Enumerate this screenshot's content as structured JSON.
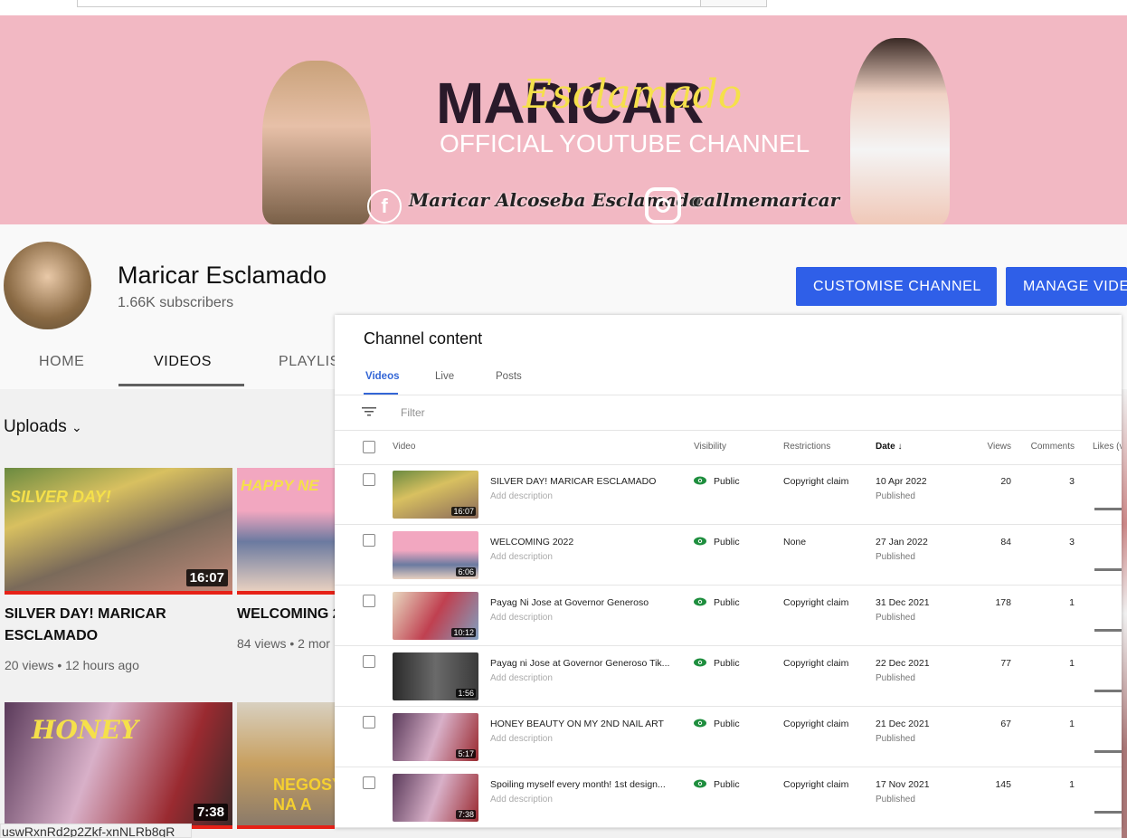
{
  "banner": {
    "title": "MARICAR",
    "script": "Esclamado",
    "subtitle": "OFFICIAL YOUTUBE CHANNEL",
    "facebook": "Maricar Alcoseba Esclamado",
    "instagram": "callmemaricar",
    "bg": "#f2b8c3"
  },
  "channel": {
    "name": "Maricar Esclamado",
    "subscribers": "1.66K subscribers",
    "customise_label": "CUSTOMISE CHANNEL",
    "manage_label": "MANAGE VIDE",
    "accent": "#2f5fe8"
  },
  "tabs": [
    {
      "label": "HOME"
    },
    {
      "label": "VIDEOS"
    },
    {
      "label": "PLAYLIS"
    }
  ],
  "uploads": {
    "label": "Uploads"
  },
  "grid": [
    {
      "title": "SILVER DAY! MARICAR ESCLAMADO",
      "meta": "20 views • 12 hours ago",
      "duration": "16:07"
    },
    {
      "title": "WELCOMING 2",
      "meta": "84 views • 2 mor",
      "overlay": "HAPPY NE"
    },
    {
      "duration": "7:38",
      "overlay": "HONEY"
    },
    {
      "overlay": "NEGOSY NA A"
    }
  ],
  "tooltip": "uswRxnRd2p2Zkf-xnNLRb8gR",
  "panel": {
    "title": "Channel content",
    "tabs": [
      "Videos",
      "Live",
      "Posts"
    ],
    "filter_placeholder": "Filter",
    "columns": {
      "video": "Video",
      "visibility": "Visibility",
      "restrictions": "Restrictions",
      "date": "Date",
      "views": "Views",
      "comments": "Comments",
      "likes": "Likes (v"
    },
    "rows": [
      {
        "title": "SILVER DAY! MARICAR ESCLAMADO",
        "desc": "Add description",
        "duration": "16:07",
        "visibility": "Public",
        "restrictions": "Copyright claim",
        "date": "10 Apr 2022",
        "status": "Published",
        "views": "20",
        "comments": "3"
      },
      {
        "title": "WELCOMING 2022",
        "desc": "Add description",
        "duration": "6:06",
        "visibility": "Public",
        "restrictions": "None",
        "date": "27 Jan 2022",
        "status": "Published",
        "views": "84",
        "comments": "3"
      },
      {
        "title": "Payag Ni Jose at Governor Generoso",
        "desc": "Add description",
        "duration": "10:12",
        "visibility": "Public",
        "restrictions": "Copyright claim",
        "date": "31 Dec 2021",
        "status": "Published",
        "views": "178",
        "comments": "1"
      },
      {
        "title": "Payag ni Jose at Governor Generoso Tik...",
        "desc": "Add description",
        "duration": "1:56",
        "visibility": "Public",
        "restrictions": "Copyright claim",
        "date": "22 Dec 2021",
        "status": "Published",
        "views": "77",
        "comments": "1"
      },
      {
        "title": "HONEY BEAUTY ON MY 2ND NAIL ART",
        "desc": "Add description",
        "duration": "5:17",
        "visibility": "Public",
        "restrictions": "Copyright claim",
        "date": "21 Dec 2021",
        "status": "Published",
        "views": "67",
        "comments": "1"
      },
      {
        "title": "Spoiling myself every month! 1st design...",
        "desc": "Add description",
        "duration": "7:38",
        "visibility": "Public",
        "restrictions": "Copyright claim",
        "date": "17 Nov 2021",
        "status": "Published",
        "views": "145",
        "comments": "1"
      }
    ]
  }
}
